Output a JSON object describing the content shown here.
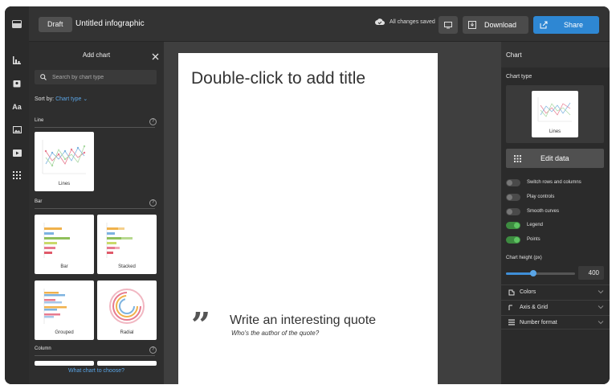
{
  "header": {
    "draft_label": "Draft",
    "doc_title": "Untitled infographic",
    "save_status": "All changes saved",
    "download_label": "Download",
    "share_label": "Share"
  },
  "rail": {
    "icons": [
      "charts-icon",
      "map-icon",
      "text-icon",
      "image-icon",
      "video-icon",
      "grid-icon"
    ]
  },
  "add_chart": {
    "title": "Add chart",
    "search_placeholder": "Search by chart type",
    "sort_prefix": "Sort by:",
    "sort_value": "Chart type",
    "sections": {
      "line": "Line",
      "bar": "Bar",
      "column": "Column"
    },
    "cards": {
      "lines": "Lines",
      "bar": "Bar",
      "stacked": "Stacked",
      "grouped": "Grouped",
      "radial": "Radial"
    },
    "help_glyph": "?",
    "footer_link": "What chart to choose?"
  },
  "canvas": {
    "title_placeholder": "Double-click to add title",
    "quote_glyph": "”",
    "quote_text": "Write an interesting quote",
    "quote_author": "Who's the author of the quote?"
  },
  "settings": {
    "header": "Chart",
    "chart_type_label": "Chart type",
    "chart_type_value": "Lines",
    "edit_data_label": "Edit data",
    "toggles": [
      {
        "label": "Switch rows and columns",
        "on": false
      },
      {
        "label": "Play controls",
        "on": false
      },
      {
        "label": "Smooth curves",
        "on": false
      },
      {
        "label": "Legend",
        "on": true
      },
      {
        "label": "Points",
        "on": true
      }
    ],
    "chart_height_label": "Chart height (px)",
    "chart_height_value": "400",
    "chart_height_fraction": 0.4,
    "accordions": {
      "colors": "Colors",
      "axis_grid": "Axis & Grid",
      "number_format": "Number format"
    }
  },
  "colors": {
    "accent": "#2e87d3",
    "toggle_on": "#5fc463",
    "link": "#5aa5e6"
  }
}
